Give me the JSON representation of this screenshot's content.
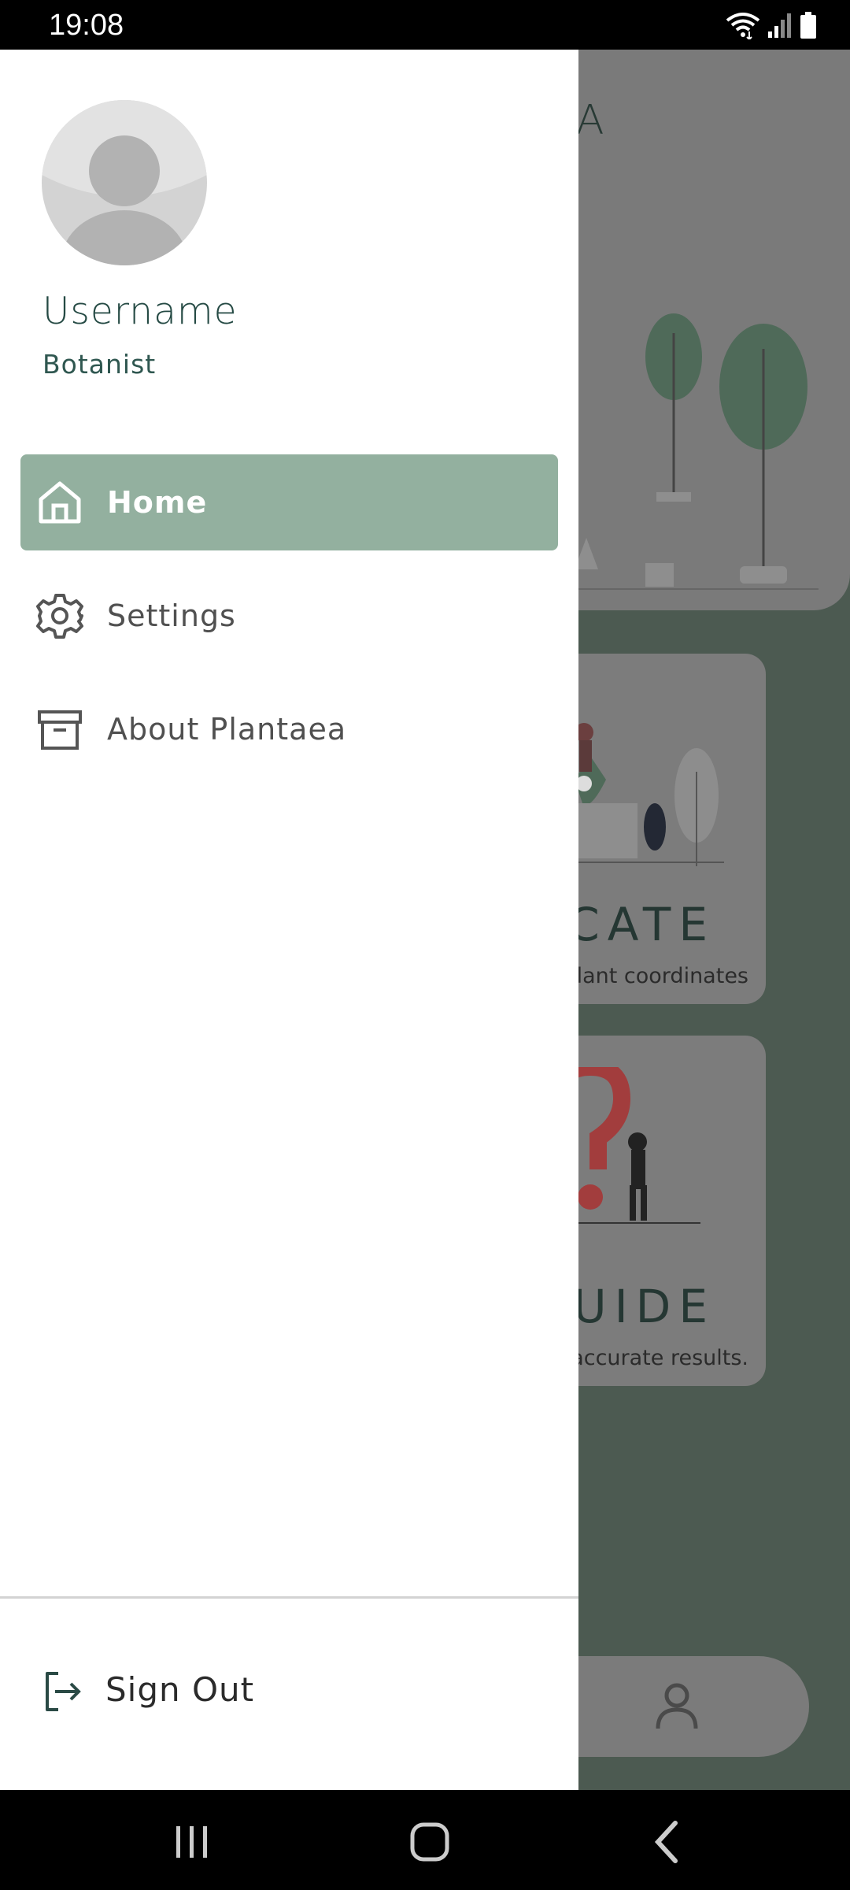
{
  "status_bar": {
    "time": "19:08",
    "icons": [
      "wifi-icon",
      "signal-icon",
      "battery-icon"
    ]
  },
  "background_app": {
    "hero_letter": "A",
    "cards": [
      {
        "title": "CATE",
        "subtitle": "lant coordinates"
      },
      {
        "title": "UIDE",
        "subtitle": "accurate results."
      }
    ],
    "bottom_nav_icon": "profile-icon"
  },
  "drawer": {
    "profile": {
      "avatar_icon": "avatar-placeholder-icon",
      "username": "Username",
      "role": "Botanist"
    },
    "menu": [
      {
        "label": "Home",
        "icon": "home-icon",
        "active": true
      },
      {
        "label": "Settings",
        "icon": "gear-icon",
        "active": false
      },
      {
        "label": "About Plantaea",
        "icon": "archive-box-icon",
        "active": false
      }
    ],
    "sign_out": {
      "label": "Sign Out",
      "icon": "sign-out-icon"
    }
  },
  "system_nav": {
    "buttons": [
      "recents-icon",
      "home-circle-icon",
      "back-icon"
    ]
  },
  "colors": {
    "drawer_active": "#93b09f",
    "app_background": "#4c5a51",
    "accent_text": "#254a44"
  }
}
